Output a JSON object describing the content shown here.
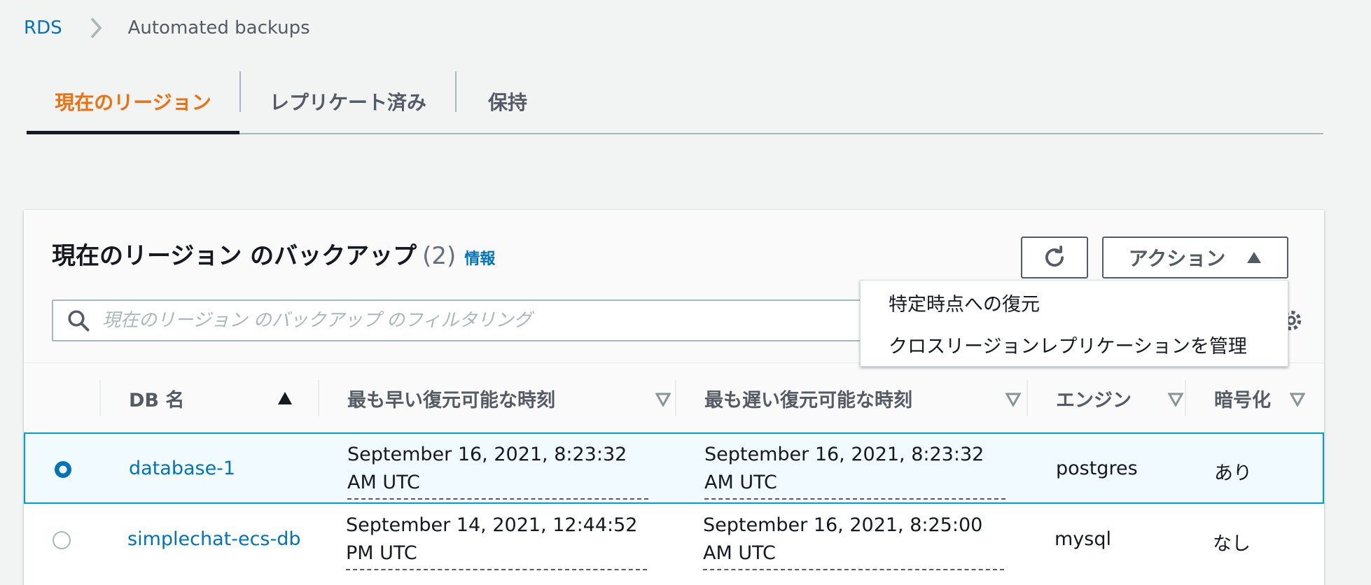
{
  "breadcrumb": {
    "root": "RDS",
    "current": "Automated backups"
  },
  "tabs": [
    {
      "label": "現在のリージョン",
      "active": true
    },
    {
      "label": "レプリケート済み",
      "active": false
    },
    {
      "label": "保持",
      "active": false
    }
  ],
  "panel": {
    "title": "現在のリージョン のバックアップ",
    "count": "(2)",
    "info_link": "情報",
    "actions_label": "アクション",
    "search_placeholder": "現在のリージョン のバックアップ のフィルタリング"
  },
  "actions_menu": {
    "items": [
      "特定時点への復元",
      "クロスリージョンレプリケーションを管理"
    ]
  },
  "table": {
    "columns": [
      "DB 名",
      "最も早い復元可能な時刻",
      "最も遅い復元可能な時刻",
      "エンジン",
      "暗号化"
    ],
    "rows": [
      {
        "selected": true,
        "db_name": "database-1",
        "earliest": "September 16, 2021, 8:23:32 AM UTC",
        "latest": "September 16, 2021, 8:23:32 AM UTC",
        "engine": "postgres",
        "encryption": "あり"
      },
      {
        "selected": false,
        "db_name": "simplechat-ecs-db",
        "earliest": "September 14, 2021, 12:44:52 PM UTC",
        "latest": "September 16, 2021, 8:25:00 AM UTC",
        "engine": "mysql",
        "encryption": "なし"
      }
    ]
  },
  "colors": {
    "accent": "#ec7211",
    "link": "#0073bb",
    "selected_row": "#f1faff",
    "selected_border": "#00a1c9"
  },
  "icons": {
    "breadcrumb_separator": "chevron-right-icon",
    "refresh": "refresh-icon",
    "actions_caret": "caret-up-icon",
    "search": "search-icon",
    "settings": "gear-icon",
    "sort_asc": "sort-ascending-icon",
    "sort_none": "sort-neutral-icon"
  }
}
